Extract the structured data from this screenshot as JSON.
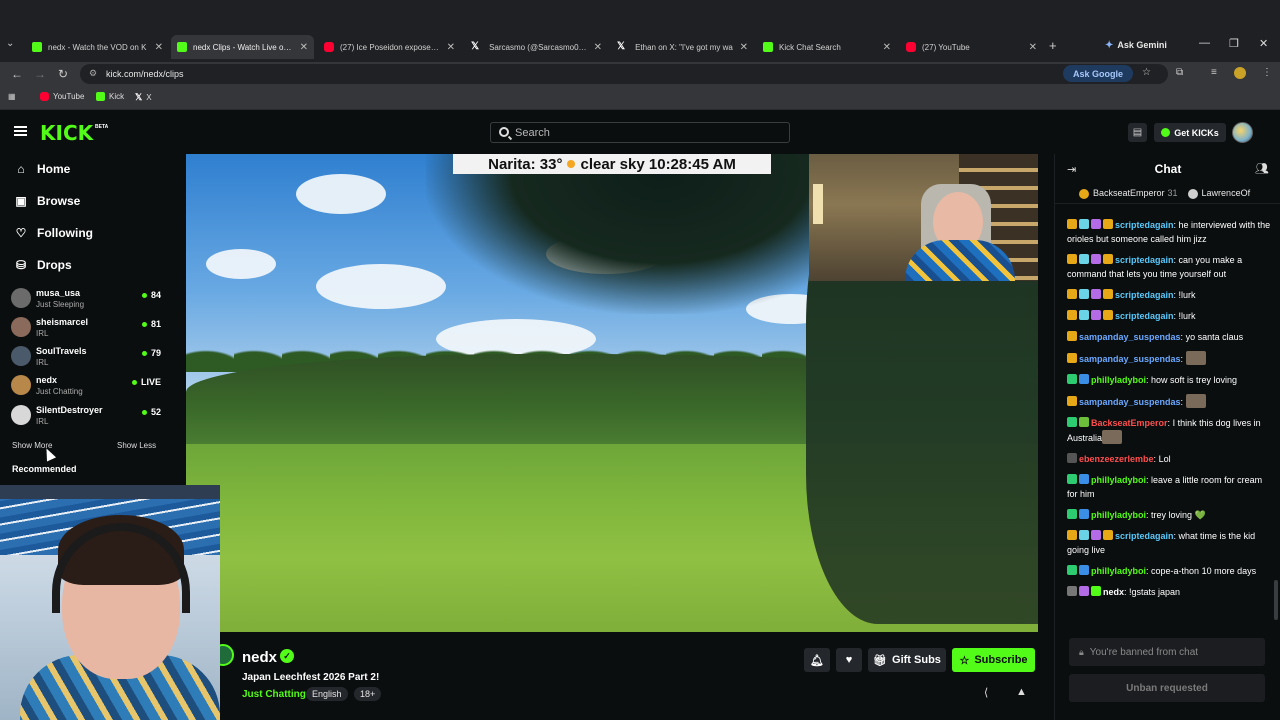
{
  "browser": {
    "tabs": [
      {
        "label": "nedx - Watch the VOD on K",
        "favicon": "kick",
        "active": false
      },
      {
        "label": "nedx Clips - Watch Live on K",
        "favicon": "kick",
        "active": true
      },
      {
        "label": "(27) Ice Poseidon exposes N",
        "favicon": "youtube",
        "active": false
      },
      {
        "label": "Sarcasmo (@Sarcasmo0110",
        "favicon": "x",
        "active": false
      },
      {
        "label": "Ethan on X: \"I've got my wa",
        "favicon": "x",
        "active": false
      },
      {
        "label": "Kick Chat Search",
        "favicon": "kick",
        "active": false
      },
      {
        "label": "(27) YouTube",
        "favicon": "youtube",
        "active": false
      }
    ],
    "ask_gemini": "Ask Gemini",
    "url": "kick.com/nedx/clips",
    "ask_google": "Ask Google",
    "bookmarks": [
      {
        "label": "YouTube",
        "favicon": "youtube"
      },
      {
        "label": "Kick",
        "favicon": "kick"
      },
      {
        "label": "X",
        "favicon": "x"
      }
    ]
  },
  "kick": {
    "logo": "KICK",
    "logo_badge": "BETA",
    "search_placeholder": "Search",
    "get_kicks": "Get KICKs",
    "accent": "#53fc18"
  },
  "sidebar": {
    "nav": [
      {
        "label": "Home",
        "icon": "home-icon"
      },
      {
        "label": "Browse",
        "icon": "browse-icon"
      },
      {
        "label": "Following",
        "icon": "heart-icon"
      },
      {
        "label": "Drops",
        "icon": "drops-icon"
      }
    ],
    "channels": [
      {
        "name": "musa_usa",
        "category": "Just Sleeping",
        "viewers": "84",
        "avatar_color": "#6b6b6b"
      },
      {
        "name": "sheismarcel",
        "category": "IRL",
        "viewers": "81",
        "avatar_color": "#8a6a5a"
      },
      {
        "name": "SoulTravels",
        "category": "IRL",
        "viewers": "79",
        "avatar_color": "#4a5a6a"
      },
      {
        "name": "nedx",
        "category": "Just Chatting",
        "viewers": "LIVE",
        "avatar_color": "#b8874a"
      },
      {
        "name": "SilentDestroyer",
        "category": "IRL",
        "viewers": "52",
        "avatar_color": "#d8d8d8"
      }
    ],
    "show_more": "Show More",
    "show_less": "Show Less",
    "recommended": "Recommended"
  },
  "video": {
    "weather_left": "Narita: 33°",
    "weather_right": "clear sky 10:28:45 AM"
  },
  "stream": {
    "name": "nedx",
    "title": "Japan Leechfest 2026 Part 2!",
    "category": "Just Chatting",
    "tags": [
      "English",
      "18+"
    ],
    "gift_subs": "Gift Subs",
    "subscribe": "Subscribe"
  },
  "chat": {
    "title": "Chat",
    "pinned": {
      "user1": "BackseatEmperor",
      "count1": "31",
      "user2": "LawrenceOf"
    },
    "messages": [
      {
        "user": "scriptedagain",
        "color": "#5ac8fa",
        "text": "he interviewed with the orioles but someone called him jizz",
        "badges": [
          "#e6a817",
          "#6bd3e6",
          "#b46be6",
          "#e6a817"
        ]
      },
      {
        "user": "scriptedagain",
        "color": "#5ac8fa",
        "text": "can you make a command that lets you time yourself out",
        "badges": [
          "#e6a817",
          "#6bd3e6",
          "#b46be6",
          "#e6a817"
        ]
      },
      {
        "user": "scriptedagain",
        "color": "#5ac8fa",
        "text": "!lurk",
        "badges": [
          "#e6a817",
          "#6bd3e6",
          "#b46be6",
          "#e6a817"
        ]
      },
      {
        "user": "scriptedagain",
        "color": "#5ac8fa",
        "text": "!lurk",
        "badges": [
          "#e6a817",
          "#6bd3e6",
          "#b46be6",
          "#e6a817"
        ]
      },
      {
        "user": "sampanday_suspendas",
        "color": "#6aa8ff",
        "text": "yo santa claus",
        "badges": [
          "#e6a817"
        ]
      },
      {
        "user": "sampanday_suspendas",
        "color": "#6aa8ff",
        "text": "",
        "badges": [
          "#e6a817"
        ],
        "emote": true
      },
      {
        "user": "phillyladyboi",
        "color": "#53fc18",
        "text": "how soft is trey loving",
        "badges": [
          "#2ecc71",
          "#3a8ee6"
        ]
      },
      {
        "user": "sampanday_suspendas",
        "color": "#6aa8ff",
        "text": "",
        "badges": [
          "#e6a817"
        ],
        "emote": true
      },
      {
        "user": "BackseatEmperor",
        "color": "#ff4d4d",
        "text": "I think this dog lives in Australia",
        "badges": [
          "#2ecc71",
          "#6bbf3a"
        ],
        "emote": true
      },
      {
        "user": "ebenzeezerlembe",
        "color": "#ff4d4d",
        "text": "Lol",
        "badges": [
          "#555555"
        ]
      },
      {
        "user": "phillyladyboi",
        "color": "#53fc18",
        "text": "leave a little room for cream for him",
        "badges": [
          "#2ecc71",
          "#3a8ee6"
        ]
      },
      {
        "user": "phillyladyboi",
        "color": "#53fc18",
        "text": "trey loving 💚",
        "badges": [
          "#2ecc71",
          "#3a8ee6"
        ]
      },
      {
        "user": "scriptedagain",
        "color": "#5ac8fa",
        "text": "what time is the kid going live",
        "badges": [
          "#e6a817",
          "#6bd3e6",
          "#b46be6",
          "#e6a817"
        ]
      },
      {
        "user": "phillyladyboi",
        "color": "#53fc18",
        "text": "cope-a-thon 10 more days",
        "badges": [
          "#2ecc71",
          "#3a8ee6"
        ]
      },
      {
        "user": "nedx",
        "color": "#ffffff",
        "text": "!gstats japan",
        "badges": [
          "#777777",
          "#b46be6",
          "#53fc18"
        ]
      }
    ],
    "input_placeholder": "You're banned from chat",
    "unban": "Unban requested"
  }
}
